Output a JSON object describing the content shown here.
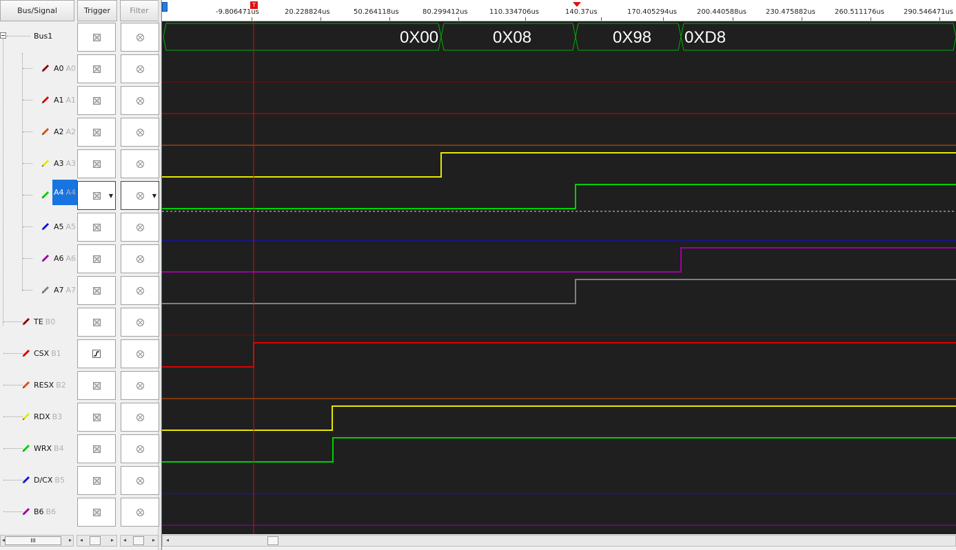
{
  "headers": {
    "bus_signal": "Bus/Signal",
    "trigger": "Trigger",
    "filter": "Filter"
  },
  "ruler": {
    "ticks": [
      "-9.806471us",
      "20.228824us",
      "50.264118us",
      "80.299412us",
      "110.334706us",
      "140.37us",
      "170.405294us",
      "200.440588us",
      "230.475882us",
      "260.511176us",
      "290.546471us"
    ],
    "trigger_marker": "T"
  },
  "bus": {
    "name": "Bus1",
    "values": [
      "0X00",
      "0X08",
      "0X98",
      "0XD8"
    ],
    "color": "#00b000"
  },
  "signals": [
    {
      "name": "A0",
      "ch": "A0",
      "color": "#8b0000"
    },
    {
      "name": "A1",
      "ch": "A1",
      "color": "#e00000"
    },
    {
      "name": "A2",
      "ch": "A2",
      "color": "#e05000"
    },
    {
      "name": "A3",
      "ch": "A3",
      "color": "#e8e800"
    },
    {
      "name": "A4",
      "ch": "A4",
      "color": "#00d000",
      "selected": true
    },
    {
      "name": "A5",
      "ch": "A5",
      "color": "#1010e0"
    },
    {
      "name": "A6",
      "ch": "A6",
      "color": "#a000a0"
    },
    {
      "name": "A7",
      "ch": "A7",
      "color": "#808080"
    },
    {
      "name": "TE",
      "ch": "B0",
      "color": "#8b0000"
    },
    {
      "name": "CSX",
      "ch": "B1",
      "color": "#e00000",
      "trigger": "rising"
    },
    {
      "name": "RESX",
      "ch": "B2",
      "color": "#e05000"
    },
    {
      "name": "RDX",
      "ch": "B3",
      "color": "#e8e800"
    },
    {
      "name": "WRX",
      "ch": "B4",
      "color": "#00d000"
    },
    {
      "name": "D/CX",
      "ch": "B5",
      "color": "#1010e0"
    },
    {
      "name": "B6",
      "ch": "B6",
      "color": "#a000a0"
    }
  ],
  "scrollbars": {
    "signal_thumb": "III"
  }
}
